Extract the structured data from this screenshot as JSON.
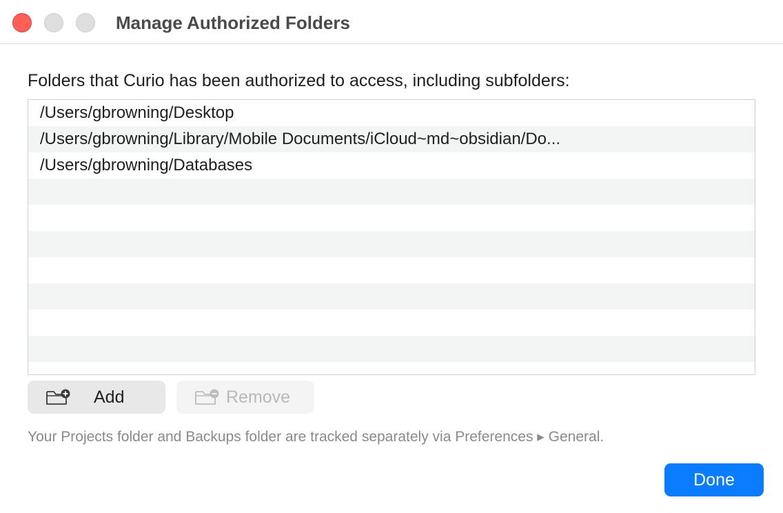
{
  "window": {
    "title": "Manage Authorized Folders"
  },
  "prompt": "Folders that Curio has been authorized to access, including subfolders:",
  "folders": [
    "/Users/gbrowning/Desktop",
    "/Users/gbrowning/Library/Mobile Documents/iCloud~md~obsidian/Do...",
    "/Users/gbrowning/Databases"
  ],
  "actions": {
    "add_label": "Add",
    "add_icon": "folder-plus-icon",
    "remove_label": "Remove",
    "remove_icon": "folder-minus-icon"
  },
  "footnote": "Your Projects folder and Backups folder are tracked separately via Preferences ▸ General.",
  "done_label": "Done",
  "colors": {
    "accent": "#0a7cff",
    "close": "#fe5f57"
  }
}
